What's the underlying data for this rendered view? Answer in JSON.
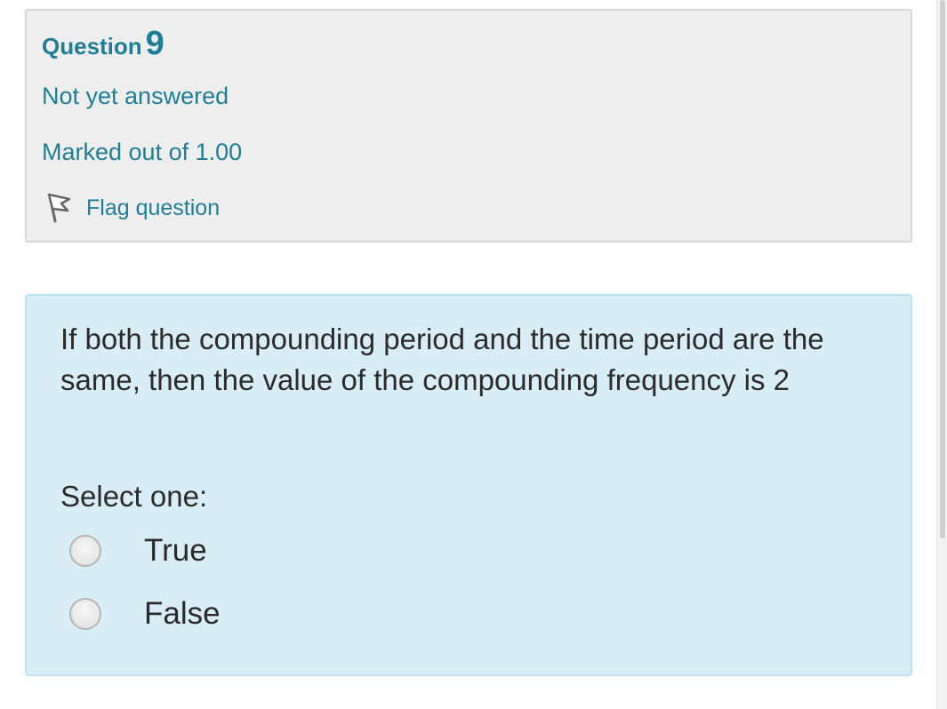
{
  "question_info": {
    "title_prefix": "Question",
    "number": "9",
    "state": "Not yet answered",
    "grade": "Marked out of 1.00",
    "flag": {
      "icon": "flag-icon",
      "label": "Flag question"
    }
  },
  "question": {
    "text": "If both the compounding period and the time period are the same, then the value of the compounding frequency is 2",
    "prompt": "Select one:",
    "options": [
      {
        "label": "True",
        "selected": false
      },
      {
        "label": "False",
        "selected": false
      }
    ]
  },
  "colors": {
    "accent": "#1f7e95",
    "info_background": "#eeeeee",
    "content_background": "#d9edf7",
    "text": "#2b2b2b"
  }
}
